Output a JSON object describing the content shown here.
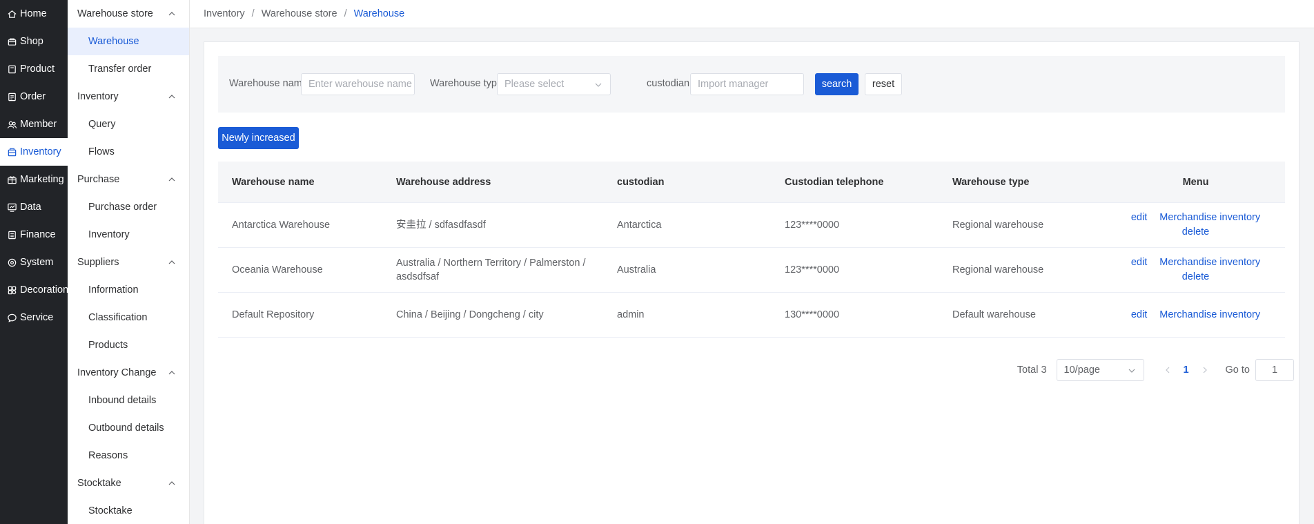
{
  "nav": [
    {
      "label": "Home",
      "icon": "home-icon"
    },
    {
      "label": "Shop",
      "icon": "shop-icon"
    },
    {
      "label": "Product",
      "icon": "product-icon"
    },
    {
      "label": "Order",
      "icon": "order-icon"
    },
    {
      "label": "Member",
      "icon": "member-icon"
    },
    {
      "label": "Inventory",
      "icon": "inventory-icon",
      "active": true
    },
    {
      "label": "Marketing",
      "icon": "marketing-icon"
    },
    {
      "label": "Data",
      "icon": "data-icon"
    },
    {
      "label": "Finance",
      "icon": "finance-icon"
    },
    {
      "label": "System",
      "icon": "system-icon"
    },
    {
      "label": "Decoration",
      "icon": "decoration-icon"
    },
    {
      "label": "Service",
      "icon": "service-icon"
    }
  ],
  "submenu": {
    "groups": [
      {
        "label": "Warehouse store",
        "items": [
          "Warehouse",
          "Transfer order"
        ]
      },
      {
        "label": "Inventory",
        "items": [
          "Query",
          "Flows"
        ]
      },
      {
        "label": "Purchase",
        "items": [
          "Purchase order",
          "Inventory"
        ]
      },
      {
        "label": "Suppliers",
        "items": [
          "Information",
          "Classification",
          "Products"
        ]
      },
      {
        "label": "Inventory Change",
        "items": [
          "Inbound details",
          "Outbound details",
          "Reasons"
        ]
      },
      {
        "label": "Stocktake",
        "items": [
          "Stocktake"
        ]
      }
    ],
    "active_item": "Warehouse"
  },
  "breadcrumb": [
    "Inventory",
    "Warehouse store",
    "Warehouse"
  ],
  "filter": {
    "name_label": "Warehouse name:",
    "name_placeholder": "Enter warehouse name",
    "type_label": "Warehouse type:",
    "type_placeholder": "Please select",
    "custodian_label": "custodian:",
    "custodian_placeholder": "Import manager",
    "search_label": "search",
    "reset_label": "reset"
  },
  "add_button_label": "Newly increased",
  "table": {
    "columns": [
      "Warehouse name",
      "Warehouse address",
      "custodian",
      "Custodian telephone",
      "Warehouse type",
      "Menu"
    ],
    "rows": [
      {
        "name": "Antarctica Warehouse",
        "address": "安圭拉 / sdfasdfasdf",
        "custodian": "Antarctica",
        "phone": "123****0000",
        "type": "Regional warehouse",
        "actions": [
          "edit",
          "Merchandise inventory",
          "delete"
        ]
      },
      {
        "name": "Oceania Warehouse",
        "address": "Australia / Northern Territory / Palmerston / asdsdfsaf",
        "custodian": "Australia",
        "phone": "123****0000",
        "type": "Regional warehouse",
        "actions": [
          "edit",
          "Merchandise inventory",
          "delete"
        ]
      },
      {
        "name": "Default Repository",
        "address": "China / Beijing / Dongcheng / city",
        "custodian": "admin",
        "phone": "130****0000",
        "type": "Default warehouse",
        "actions": [
          "edit",
          "Merchandise inventory"
        ]
      }
    ]
  },
  "pagination": {
    "total": "Total 3",
    "page_size": "10/page",
    "current_page": "1",
    "goto_label": "Go to",
    "goto_value": "1"
  },
  "colors": {
    "primary": "#1a5bd6",
    "nav_bg": "#222428"
  }
}
